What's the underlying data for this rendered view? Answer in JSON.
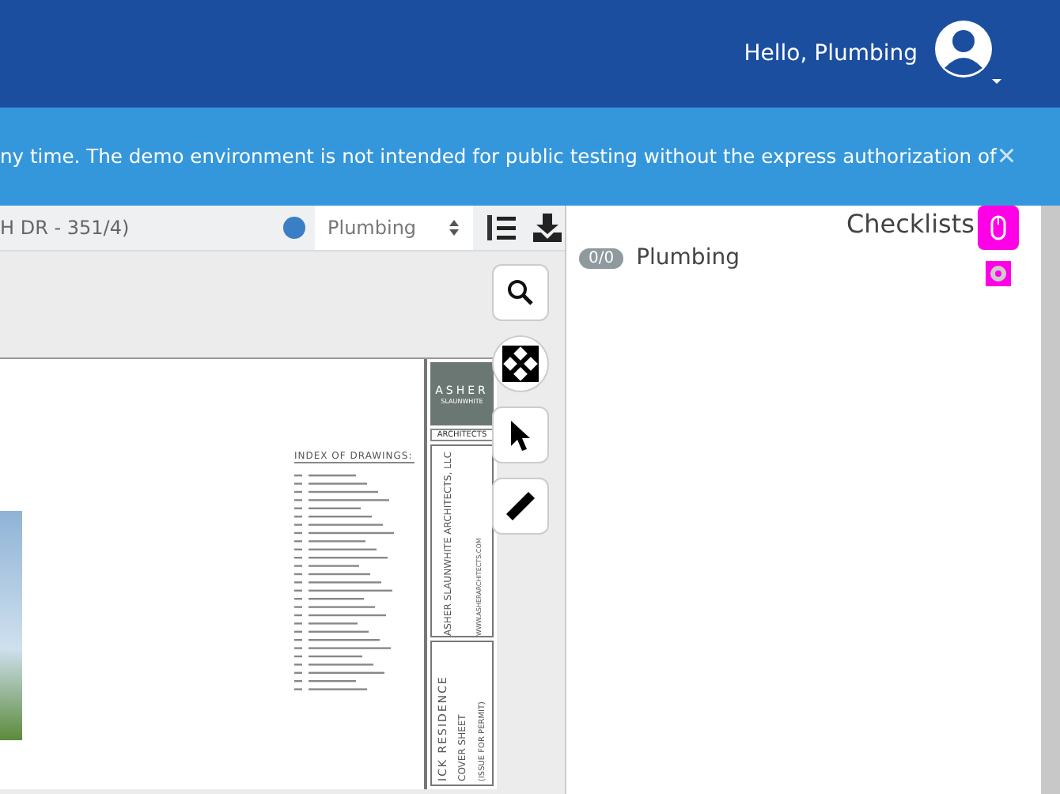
{
  "header": {
    "greeting": "Hello, Plumbing"
  },
  "banner": {
    "message": "ny time. The demo environment is not intended for public testing without the express authorization of",
    "close": "×"
  },
  "toolbar": {
    "document_title": "H DR - 351/4)",
    "trade_select": {
      "value": "Plumbing"
    }
  },
  "sheet": {
    "logo_name": "ASHER",
    "logo_sub": "SLAUNWHITE",
    "logo_firm": "ARCHITECTS",
    "index_title": "INDEX OF DRAWINGS:",
    "firm_name": "ASHER SLAUNWHITE ARCHITECTS, LLC",
    "firm_web": "WWW.ASHERARCHITECTS.COM",
    "project": "ICK RESIDENCE",
    "sheet_name": "COVER SHEET",
    "issue": "(ISSUE FOR PERMIT)"
  },
  "checklists": {
    "title": "Checklists",
    "items": [
      {
        "count": "0/0",
        "name": "Plumbing"
      }
    ]
  }
}
